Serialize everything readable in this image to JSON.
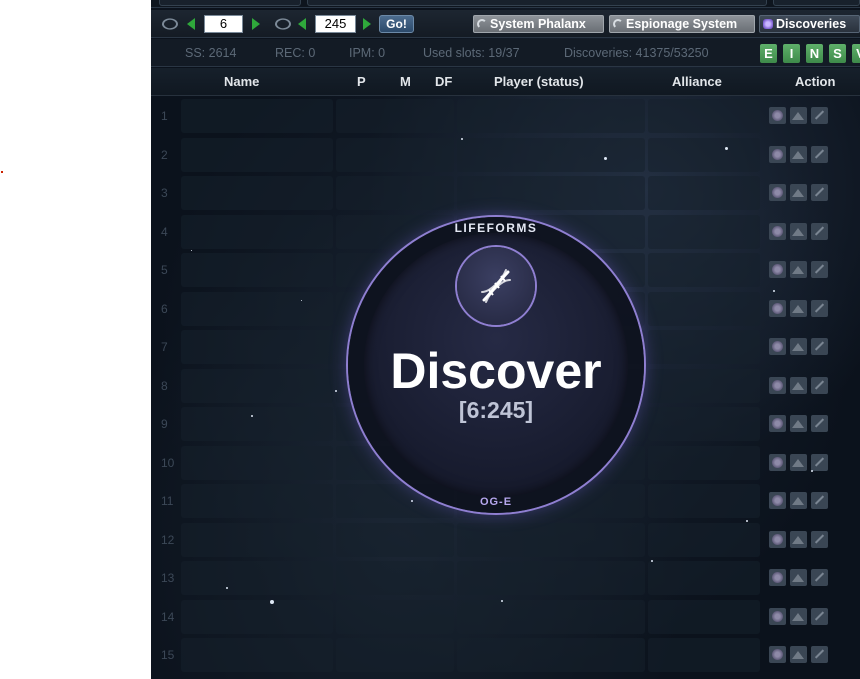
{
  "nav": {
    "galaxy": "6",
    "system": "245",
    "go_label": "Go!",
    "tools": [
      "System Phalanx",
      "Espionage System",
      "Discoveries"
    ]
  },
  "stats": {
    "ss": "SS: 2614",
    "rec": "REC: 0",
    "ipm": "IPM: 0",
    "used_slots": "Used slots: 19/37",
    "discoveries": "Discoveries: 41375/53250",
    "letters": [
      "E",
      "I",
      "N",
      "S",
      "V"
    ]
  },
  "table": {
    "headers": {
      "name": "Name",
      "p": "P",
      "m": "M",
      "df": "DF",
      "player": "Player (status)",
      "alliance": "Alliance",
      "action": "Action"
    },
    "rows": [
      "1",
      "2",
      "3",
      "4",
      "5",
      "6",
      "7",
      "8",
      "9",
      "10",
      "11",
      "12",
      "13",
      "14",
      "15"
    ]
  },
  "overlay": {
    "top_label": "LIFEFORMS",
    "title": "Discover",
    "coords": "[6:245]",
    "bottom_label": "OG-E"
  },
  "icons": {
    "galaxy_nav": "orbit-icon",
    "system_nav": "orbit-icon",
    "prev": "arrow-left-icon",
    "next": "arrow-right-icon",
    "discover_center": "dna-icon",
    "row_actions": [
      "discovery-icon",
      "mission-icon",
      "missile-icon"
    ]
  },
  "colors": {
    "accent_green": "#2fa83b",
    "overlay_ring": "#8f7fd1",
    "letter_green": "#4f9e5b"
  }
}
